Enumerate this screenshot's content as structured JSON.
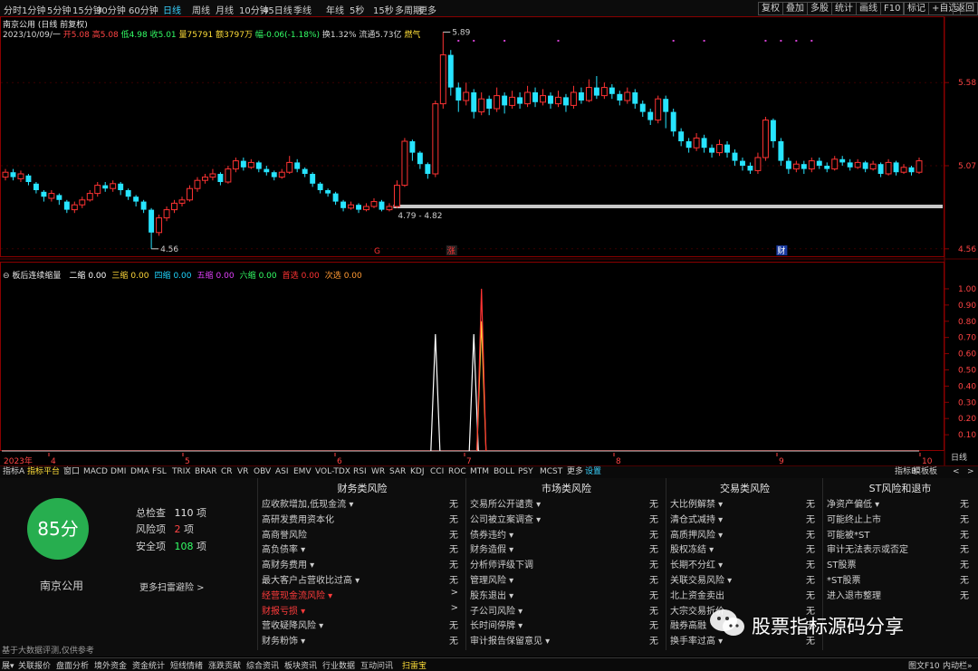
{
  "period_bar": [
    {
      "label": "分时",
      "active": false
    },
    {
      "label": "1分钟",
      "active": false
    },
    {
      "label": "5分钟",
      "active": false
    },
    {
      "label": "15分钟",
      "active": false
    },
    {
      "label": "30分钟",
      "active": false
    },
    {
      "label": "60分钟",
      "active": false
    },
    {
      "label": "日线",
      "active": true
    },
    {
      "label": "周线",
      "active": false
    },
    {
      "label": "月线",
      "active": false
    },
    {
      "label": "10分钟",
      "active": false
    },
    {
      "label": "45日线",
      "active": false
    },
    {
      "label": "季线",
      "active": false
    },
    {
      "label": "年线",
      "active": false
    },
    {
      "label": "5秒",
      "active": false
    },
    {
      "label": "15秒",
      "active": false
    },
    {
      "label": "多周期",
      "active": false
    },
    {
      "label": "更多",
      "active": false
    }
  ],
  "right_bar": [
    "复权",
    "叠加",
    "多股",
    "统计",
    "画线",
    "F10",
    "标记",
    "+自选",
    "返回"
  ],
  "price_panel": {
    "title": "南京公用 (日线 前复权)",
    "info": {
      "date": "2023/10/09/一",
      "open_label": "开",
      "open": "5.08",
      "high_label": "高",
      "high": "5.08",
      "low_label": "低",
      "low": "4.98",
      "close_label": "收",
      "close": "5.01",
      "volume_label": "量",
      "volume": "75791",
      "amount_label": "额",
      "amount": "3797万",
      "change_label": "幅",
      "change": "-0.06(-1.18%)",
      "turnover_label": "换",
      "turnover": "1.32%",
      "float_label": "流通",
      "float": "5.73亿",
      "concept": "燃气"
    },
    "annotations": {
      "high": "5.89",
      "low": "4.56",
      "range": "4.79 - 4.82"
    },
    "markers": {
      "zhang": "涨",
      "cai": "财",
      "g": "G"
    },
    "yaxis_labels": [
      "5.58",
      "5.07",
      "4.56"
    ]
  },
  "indicator_panel": {
    "title": "板后连续缩量",
    "items": [
      {
        "name": "二缩",
        "value": "0.00",
        "color": "#ffffff"
      },
      {
        "name": "三缩",
        "value": "0.00",
        "color": "#ffd83a"
      },
      {
        "name": "四缩",
        "value": "0.00",
        "color": "#1fd6ff"
      },
      {
        "name": "五缩",
        "value": "0.00",
        "color": "#e040fb"
      },
      {
        "name": "六缩",
        "value": "0.00",
        "color": "#33ff66"
      },
      {
        "name": "首选",
        "value": "0.00",
        "color": "#ff3333"
      },
      {
        "name": "次选",
        "value": "0.00",
        "color": "#ff9933"
      }
    ],
    "yaxis_labels": [
      "1.00",
      "0.90",
      "0.80",
      "0.70",
      "0.60",
      "0.50",
      "0.40",
      "0.30",
      "0.20",
      "0.10"
    ],
    "year_label": "2023年",
    "month_labels": [
      "4",
      "5",
      "6",
      "7",
      "8",
      "9",
      "10"
    ]
  },
  "chart_data": {
    "type": "candlestick",
    "title": "南京公用 (日线 前复权)",
    "ylim": [
      4.52,
      5.92
    ],
    "yticks": [
      5.58,
      5.07,
      4.56
    ],
    "candles": [
      [
        5.0,
        5.03,
        5.05,
        4.98
      ],
      [
        5.03,
        5.0,
        5.05,
        4.98
      ],
      [
        4.99,
        5.02,
        5.04,
        4.97
      ],
      [
        5.01,
        4.97,
        5.02,
        4.95
      ],
      [
        4.96,
        4.92,
        4.97,
        4.9
      ],
      [
        4.91,
        4.88,
        4.92,
        4.85
      ],
      [
        4.87,
        4.9,
        4.92,
        4.85
      ],
      [
        4.89,
        4.86,
        4.9,
        4.83
      ],
      [
        4.85,
        4.8,
        4.86,
        4.78
      ],
      [
        4.8,
        4.83,
        4.85,
        4.78
      ],
      [
        4.83,
        4.86,
        4.88,
        4.81
      ],
      [
        4.86,
        4.9,
        4.92,
        4.85
      ],
      [
        4.9,
        4.95,
        4.97,
        4.88
      ],
      [
        4.95,
        4.93,
        4.97,
        4.91
      ],
      [
        4.93,
        4.96,
        4.98,
        4.91
      ],
      [
        4.96,
        4.92,
        4.97,
        4.89
      ],
      [
        4.92,
        4.88,
        4.93,
        4.86
      ],
      [
        4.88,
        4.85,
        4.89,
        4.82
      ],
      [
        4.85,
        4.8,
        4.86,
        4.78
      ],
      [
        4.8,
        4.66,
        4.81,
        4.56
      ],
      [
        4.66,
        4.75,
        4.77,
        4.64
      ],
      [
        4.75,
        4.8,
        4.82,
        4.73
      ],
      [
        4.8,
        4.84,
        4.86,
        4.78
      ],
      [
        4.84,
        4.86,
        4.88,
        4.82
      ],
      [
        4.86,
        4.93,
        4.95,
        4.85
      ],
      [
        4.93,
        4.98,
        5.0,
        4.91
      ],
      [
        4.98,
        5.0,
        5.02,
        4.96
      ],
      [
        5.0,
        5.02,
        5.05,
        4.98
      ],
      [
        5.02,
        4.97,
        5.03,
        4.95
      ],
      [
        4.97,
        5.05,
        5.07,
        4.96
      ],
      [
        5.05,
        5.1,
        5.12,
        5.03
      ],
      [
        5.1,
        5.06,
        5.12,
        5.04
      ],
      [
        5.06,
        5.09,
        5.11,
        5.05
      ],
      [
        5.09,
        5.05,
        5.1,
        5.03
      ],
      [
        5.05,
        5.03,
        5.07,
        5.01
      ],
      [
        5.03,
        5.0,
        5.04,
        4.98
      ],
      [
        5.0,
        5.03,
        5.05,
        4.99
      ],
      [
        5.03,
        5.09,
        5.13,
        5.02
      ],
      [
        5.09,
        5.05,
        5.11,
        5.03
      ],
      [
        5.05,
        5.02,
        5.06,
        5.0
      ],
      [
        5.02,
        4.96,
        5.03,
        4.94
      ],
      [
        4.96,
        4.92,
        4.97,
        4.9
      ],
      [
        4.92,
        4.9,
        4.93,
        4.88
      ],
      [
        4.9,
        4.85,
        4.91,
        4.83
      ],
      [
        4.85,
        4.81,
        4.86,
        4.79
      ],
      [
        4.81,
        4.83,
        4.85,
        4.8
      ],
      [
        4.83,
        4.8,
        4.84,
        4.78
      ],
      [
        4.8,
        4.82,
        4.84,
        4.79
      ],
      [
        4.82,
        4.85,
        4.87,
        4.81
      ],
      [
        4.85,
        4.8,
        4.86,
        4.79
      ],
      [
        4.8,
        4.82,
        4.84,
        4.79
      ],
      [
        4.82,
        4.95,
        4.98,
        4.81
      ],
      [
        4.95,
        5.22,
        5.24,
        4.94
      ],
      [
        5.22,
        5.15,
        5.23,
        5.1
      ],
      [
        5.15,
        5.08,
        5.16,
        5.05
      ],
      [
        5.08,
        5.02,
        5.09,
        4.99
      ],
      [
        5.02,
        5.45,
        5.47,
        5.0
      ],
      [
        5.45,
        5.75,
        5.89,
        5.42
      ],
      [
        5.75,
        5.55,
        5.78,
        5.5
      ],
      [
        5.55,
        5.47,
        5.58,
        5.4
      ],
      [
        5.47,
        5.52,
        5.58,
        5.44
      ],
      [
        5.52,
        5.4,
        5.54,
        5.36
      ],
      [
        5.4,
        5.48,
        5.52,
        5.38
      ],
      [
        5.48,
        5.42,
        5.5,
        5.38
      ],
      [
        5.42,
        5.5,
        5.55,
        5.4
      ],
      [
        5.5,
        5.44,
        5.52,
        5.39
      ],
      [
        5.44,
        5.49,
        5.53,
        5.42
      ],
      [
        5.49,
        5.45,
        5.52,
        5.42
      ],
      [
        5.45,
        5.52,
        5.56,
        5.43
      ],
      [
        5.52,
        5.46,
        5.55,
        5.43
      ],
      [
        5.46,
        5.5,
        5.54,
        5.44
      ],
      [
        5.5,
        5.45,
        5.52,
        5.42
      ],
      [
        5.45,
        5.49,
        5.53,
        5.43
      ],
      [
        5.49,
        5.44,
        5.51,
        5.4
      ],
      [
        5.44,
        5.52,
        5.56,
        5.42
      ],
      [
        5.52,
        5.47,
        5.55,
        5.45
      ],
      [
        5.47,
        5.55,
        5.6,
        5.46
      ],
      [
        5.55,
        5.5,
        5.62,
        5.48
      ],
      [
        5.5,
        5.55,
        5.58,
        5.48
      ],
      [
        5.55,
        5.51,
        5.57,
        5.48
      ],
      [
        5.51,
        5.47,
        5.53,
        5.44
      ],
      [
        5.47,
        5.52,
        5.55,
        5.45
      ],
      [
        5.52,
        5.45,
        5.54,
        5.42
      ],
      [
        5.45,
        5.4,
        5.47,
        5.37
      ],
      [
        5.4,
        5.35,
        5.42,
        5.32
      ],
      [
        5.35,
        5.48,
        5.5,
        5.33
      ],
      [
        5.48,
        5.4,
        5.5,
        5.3
      ],
      [
        5.4,
        5.28,
        5.42,
        5.25
      ],
      [
        5.28,
        5.22,
        5.3,
        5.19
      ],
      [
        5.22,
        5.18,
        5.24,
        5.15
      ],
      [
        5.18,
        5.24,
        5.27,
        5.16
      ],
      [
        5.24,
        5.18,
        5.26,
        5.15
      ],
      [
        5.18,
        5.15,
        5.2,
        5.12
      ],
      [
        5.15,
        5.2,
        5.23,
        5.13
      ],
      [
        5.2,
        5.15,
        5.22,
        5.12
      ],
      [
        5.15,
        5.1,
        5.17,
        5.07
      ],
      [
        5.1,
        5.07,
        5.12,
        5.04
      ],
      [
        5.07,
        5.04,
        5.09,
        5.02
      ],
      [
        5.04,
        5.12,
        5.15,
        5.02
      ],
      [
        5.12,
        5.35,
        5.37,
        5.1
      ],
      [
        5.35,
        5.22,
        5.36,
        5.18
      ],
      [
        5.22,
        5.1,
        5.24,
        5.07
      ],
      [
        5.1,
        5.05,
        5.12,
        5.02
      ],
      [
        5.05,
        5.08,
        5.1,
        5.03
      ],
      [
        5.08,
        5.05,
        5.1,
        5.02
      ],
      [
        5.05,
        5.1,
        5.12,
        5.03
      ],
      [
        5.1,
        5.07,
        5.12,
        5.05
      ],
      [
        5.07,
        5.05,
        5.09,
        5.03
      ],
      [
        5.05,
        5.11,
        5.13,
        5.04
      ],
      [
        5.11,
        5.09,
        5.13,
        5.07
      ],
      [
        5.09,
        5.06,
        5.11,
        5.04
      ],
      [
        5.06,
        5.09,
        5.11,
        5.05
      ],
      [
        5.09,
        5.05,
        5.1,
        5.03
      ],
      [
        5.05,
        5.08,
        5.1,
        5.04
      ],
      [
        5.08,
        5.02,
        5.09,
        5.0
      ],
      [
        5.02,
        5.09,
        5.11,
        5.01
      ],
      [
        5.09,
        5.03,
        5.1,
        5.01
      ],
      [
        5.03,
        5.06,
        5.08,
        5.02
      ],
      [
        5.06,
        5.03,
        5.07,
        5.01
      ],
      [
        5.03,
        5.1,
        5.12,
        5.02
      ]
    ],
    "support_line": {
      "from_index": 51,
      "value": 4.82
    }
  },
  "indicator_data": {
    "type": "line",
    "ylim": [
      0,
      1.05
    ],
    "peaks": [
      {
        "series": "二缩",
        "index": 56,
        "value": 0.72,
        "color": "#ffffff"
      },
      {
        "series": "二缩",
        "index": 61,
        "value": 0.72,
        "color": "#ffffff"
      },
      {
        "series": "三缩",
        "index": 62,
        "value": 0.8,
        "color": "#ffd83a"
      },
      {
        "series": "首选",
        "index": 62,
        "value": 1.0,
        "color": "#ff3333"
      }
    ]
  },
  "tabs": {
    "left": [
      "指标A",
      "指标平台",
      "窗口",
      "MACD",
      "DMI",
      "DMA",
      "FSL",
      "TRIX",
      "BRAR",
      "CR",
      "VR",
      "OBV",
      "ASI",
      "EMV",
      "VOL-TDX",
      "RSI",
      "WR",
      "SAR",
      "KDJ",
      "CCI",
      "ROC",
      "MTM",
      "BOLL",
      "PSY",
      "MCST",
      "更多",
      "设置"
    ],
    "right": [
      "指标B",
      "模板",
      "板"
    ],
    "right2": [
      "日线",
      "<",
      ">"
    ]
  },
  "risk": {
    "score": "85分",
    "company": "南京公用",
    "total_label": "总检查",
    "total_value": "110",
    "total_unit": "项",
    "risk_label": "风险项",
    "risk_value": "2",
    "risk_unit": "项",
    "safe_label": "安全项",
    "safe_value": "108",
    "safe_unit": "项",
    "more_scan": "更多扫雷避险 >",
    "disclaimer": "基于大数据评测,仅供参考",
    "columns": [
      {
        "title": "财务类风险",
        "rows": [
          {
            "label": "应收款增加,低现金流 ▾",
            "status": "无",
            "red": false
          },
          {
            "label": "高研发费用资本化",
            "status": "无",
            "red": false
          },
          {
            "label": "高商誉风险",
            "status": "无",
            "red": false
          },
          {
            "label": "高负债率 ▾",
            "status": "无",
            "red": false
          },
          {
            "label": "高财务费用 ▾",
            "status": "无",
            "red": false
          },
          {
            "label": "最大客户占营收比过高 ▾",
            "status": "无",
            "red": false
          },
          {
            "label": "经营现金流风险 ▾",
            "status": ">",
            "red": true
          },
          {
            "label": "财报亏损 ▾",
            "status": ">",
            "red": true
          },
          {
            "label": "营收疑降风险 ▾",
            "status": "无",
            "red": false
          },
          {
            "label": "财务粉饰 ▾",
            "status": "无",
            "red": false
          }
        ]
      },
      {
        "title": "市场类风险",
        "rows": [
          {
            "label": "交易所公开谴责 ▾",
            "status": "无",
            "red": false
          },
          {
            "label": "公司被立案调查 ▾",
            "status": "无",
            "red": false
          },
          {
            "label": "债券违约 ▾",
            "status": "无",
            "red": false
          },
          {
            "label": "财务造假 ▾",
            "status": "无",
            "red": false
          },
          {
            "label": "分析师评级下调",
            "status": "无",
            "red": false
          },
          {
            "label": "管理风险 ▾",
            "status": "无",
            "red": false
          },
          {
            "label": "股东退出 ▾",
            "status": "无",
            "red": false
          },
          {
            "label": "子公司风险 ▾",
            "status": "无",
            "red": false
          },
          {
            "label": "长时间停牌 ▾",
            "status": "无",
            "red": false
          },
          {
            "label": "审计报告保留意见 ▾",
            "status": "无",
            "red": false
          }
        ]
      },
      {
        "title": "交易类风险",
        "rows": [
          {
            "label": "大比例解禁 ▾",
            "status": "无",
            "red": false
          },
          {
            "label": "清仓式减持 ▾",
            "status": "无",
            "red": false
          },
          {
            "label": "高质押风险 ▾",
            "status": "无",
            "red": false
          },
          {
            "label": "股权冻结 ▾",
            "status": "无",
            "red": false
          },
          {
            "label": "长期不分红 ▾",
            "status": "无",
            "red": false
          },
          {
            "label": "关联交易风险 ▾",
            "status": "无",
            "red": false
          },
          {
            "label": "北上资金卖出",
            "status": "无",
            "red": false
          },
          {
            "label": "大宗交易折价",
            "status": "无",
            "red": false
          },
          {
            "label": "融券高融",
            "status": "无",
            "red": false
          },
          {
            "label": "换手率过高 ▾",
            "status": "无",
            "red": false
          }
        ]
      },
      {
        "title": "ST风险和退市",
        "rows": [
          {
            "label": "净资产偏低 ▾",
            "status": "无",
            "red": false
          },
          {
            "label": "可能终止上市",
            "status": "无",
            "red": false
          },
          {
            "label": "可能被*ST",
            "status": "无",
            "red": false
          },
          {
            "label": "审计无法表示或否定",
            "status": "无",
            "red": false
          },
          {
            "label": "ST股票",
            "status": "无",
            "red": false
          },
          {
            "label": "*ST股票",
            "status": "无",
            "red": false
          },
          {
            "label": "进入退市整理",
            "status": "无",
            "red": false
          }
        ]
      }
    ]
  },
  "bottom_bar": {
    "items": [
      {
        "label": "展▾",
        "active": false
      },
      {
        "label": "关联报价",
        "active": false
      },
      {
        "label": "盘面分析",
        "active": false
      },
      {
        "label": "境外资金",
        "active": false
      },
      {
        "label": "资金统计",
        "active": false
      },
      {
        "label": "短线情绪",
        "active": false
      },
      {
        "label": "涨跌贡献",
        "active": false
      },
      {
        "label": "综合资讯",
        "active": false
      },
      {
        "label": "板块资讯",
        "active": false
      },
      {
        "label": "行业数据",
        "active": false
      },
      {
        "label": "互动问讯",
        "active": false
      },
      {
        "label": "扫雷宝",
        "active": true
      }
    ],
    "right": [
      "图文F10",
      "内动栏»"
    ]
  },
  "watermark": {
    "text": "股票指标源码分享"
  }
}
